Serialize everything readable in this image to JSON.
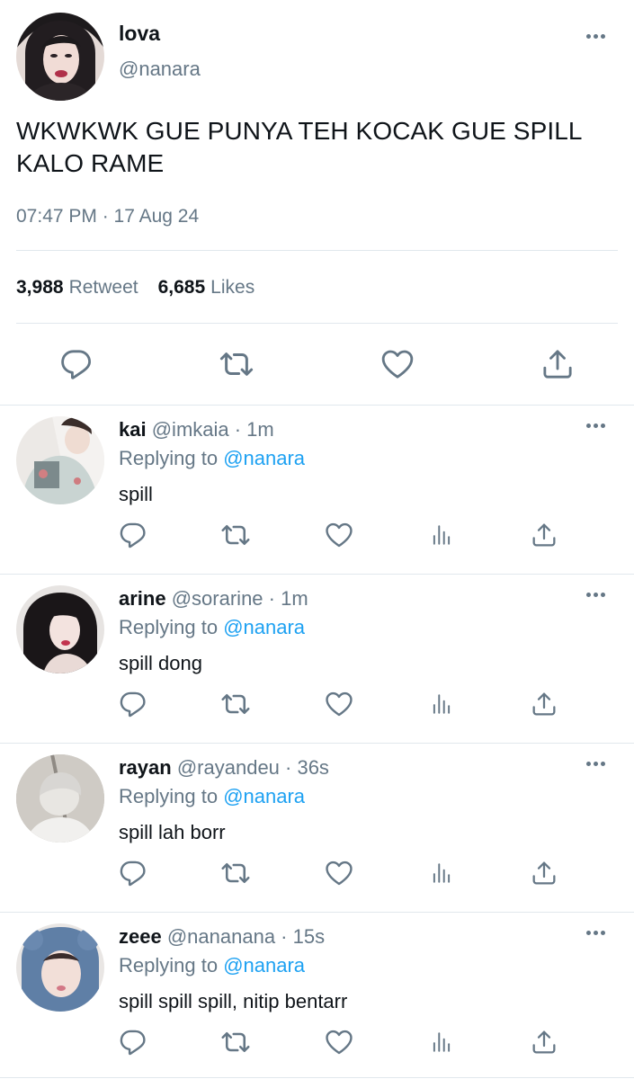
{
  "main": {
    "name": "lova",
    "handle": "@nanara",
    "text": "WKWKWK GUE PUNYA TEH KOCAK GUE SPILL KALO RAME",
    "timestamp": "07:47 PM · 17 Aug 24",
    "retweets_count": "3,988",
    "retweets_label": "Retweet",
    "likes_count": "6,685",
    "likes_label": "Likes"
  },
  "replies": [
    {
      "name": "kai",
      "meta": "@imkaia · 1m",
      "replying_prefix": "Replying to",
      "mention": "@nanara",
      "text": "spill"
    },
    {
      "name": "arine",
      "meta": "@sorarine · 1m",
      "replying_prefix": "Replying to",
      "mention": "@nanara",
      "text": "spill dong"
    },
    {
      "name": "rayan",
      "meta": "@rayandeu · 36s",
      "replying_prefix": "Replying to",
      "mention": "@nanara",
      "text": "spill lah borr"
    },
    {
      "name": "zeee",
      "meta": "@nananana · 15s",
      "replying_prefix": "Replying to",
      "mention": "@nanara",
      "text": "spill spill spill, nitip bentarr"
    }
  ],
  "icons": {
    "reply": "reply-icon",
    "retweet": "retweet-icon",
    "like": "heart-icon",
    "analytics": "analytics-icon",
    "share": "share-icon",
    "more": "more-icon"
  },
  "colors": {
    "accent": "#1da1f2",
    "muted": "#657786",
    "text": "#0f1419",
    "divider": "#e1e8ed"
  }
}
